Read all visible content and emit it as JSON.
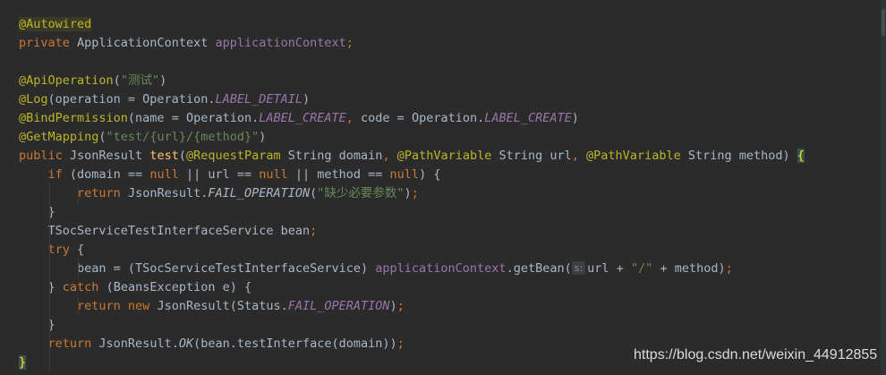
{
  "editor": {
    "lines": [
      [
        {
          "t": "@Autowired",
          "c": "ann-hl"
        }
      ],
      [
        {
          "t": "private ",
          "c": "kw"
        },
        {
          "t": "ApplicationContext ",
          "c": "plain"
        },
        {
          "t": "applicationContext",
          "c": "field"
        },
        {
          "t": ";",
          "c": "kw"
        }
      ],
      [],
      [
        {
          "t": "@ApiOperation",
          "c": "ann"
        },
        {
          "t": "(",
          "c": "plain"
        },
        {
          "t": "\"测试\"",
          "c": "str"
        },
        {
          "t": ")",
          "c": "plain"
        }
      ],
      [
        {
          "t": "@Log",
          "c": "ann"
        },
        {
          "t": "(operation = Operation.",
          "c": "plain"
        },
        {
          "t": "LABEL_DETAIL",
          "c": "static"
        },
        {
          "t": ")",
          "c": "plain"
        }
      ],
      [
        {
          "t": "@BindPermission",
          "c": "ann"
        },
        {
          "t": "(name = Operation.",
          "c": "plain"
        },
        {
          "t": "LABEL_CREATE",
          "c": "static"
        },
        {
          "t": ", ",
          "c": "kw"
        },
        {
          "t": "code = Operation.",
          "c": "plain"
        },
        {
          "t": "LABEL_CREATE",
          "c": "static"
        },
        {
          "t": ")",
          "c": "plain"
        }
      ],
      [
        {
          "t": "@GetMapping",
          "c": "ann"
        },
        {
          "t": "(",
          "c": "plain"
        },
        {
          "t": "\"test/{url}/{method}\"",
          "c": "str"
        },
        {
          "t": ")",
          "c": "plain"
        }
      ],
      [
        {
          "t": "public ",
          "c": "kw"
        },
        {
          "t": "JsonResult ",
          "c": "plain"
        },
        {
          "t": "test",
          "c": "fn"
        },
        {
          "t": "(",
          "c": "plain"
        },
        {
          "t": "@RequestParam ",
          "c": "ann"
        },
        {
          "t": "String domain",
          "c": "plain"
        },
        {
          "t": ", ",
          "c": "kw"
        },
        {
          "t": "@PathVariable ",
          "c": "ann"
        },
        {
          "t": "String url",
          "c": "plain"
        },
        {
          "t": ", ",
          "c": "kw"
        },
        {
          "t": "@PathVariable ",
          "c": "ann"
        },
        {
          "t": "String method) ",
          "c": "plain"
        },
        {
          "t": "{",
          "c": "brace-hl"
        }
      ],
      [
        {
          "t": "    ",
          "c": "plain"
        },
        {
          "t": "if ",
          "c": "kw"
        },
        {
          "t": "(domain == ",
          "c": "plain"
        },
        {
          "t": "null ",
          "c": "kw"
        },
        {
          "t": "|| url == ",
          "c": "plain"
        },
        {
          "t": "null ",
          "c": "kw"
        },
        {
          "t": "|| method == ",
          "c": "plain"
        },
        {
          "t": "null",
          "c": "kw"
        },
        {
          "t": ") {",
          "c": "plain"
        }
      ],
      [
        {
          "t": "        ",
          "c": "plain"
        },
        {
          "t": "return ",
          "c": "kw"
        },
        {
          "t": "JsonResult.",
          "c": "plain"
        },
        {
          "t": "FAIL_OPERATION",
          "c": "italic"
        },
        {
          "t": "(",
          "c": "plain"
        },
        {
          "t": "\"缺少必要参数\"",
          "c": "str"
        },
        {
          "t": ")",
          "c": "plain"
        },
        {
          "t": ";",
          "c": "kw"
        }
      ],
      [
        {
          "t": "    }",
          "c": "plain"
        }
      ],
      [
        {
          "t": "    TSocServiceTestInterfaceService bean",
          "c": "plain"
        },
        {
          "t": ";",
          "c": "kw"
        }
      ],
      [
        {
          "t": "    ",
          "c": "plain"
        },
        {
          "t": "try ",
          "c": "kw"
        },
        {
          "t": "{",
          "c": "plain"
        }
      ],
      [
        {
          "t": "        bean = (TSocServiceTestInterfaceService) ",
          "c": "plain"
        },
        {
          "t": "applicationContext",
          "c": "field"
        },
        {
          "t": ".getBean(",
          "c": "plain"
        },
        {
          "t": "s:",
          "c": "hint"
        },
        {
          "t": "url + ",
          "c": "plain"
        },
        {
          "t": "\"/\"",
          "c": "str"
        },
        {
          "t": " + method)",
          "c": "plain"
        },
        {
          "t": ";",
          "c": "kw"
        }
      ],
      [
        {
          "t": "    } ",
          "c": "plain"
        },
        {
          "t": "catch ",
          "c": "kw"
        },
        {
          "t": "(BeansException e) {",
          "c": "plain"
        }
      ],
      [
        {
          "t": "        ",
          "c": "plain"
        },
        {
          "t": "return new ",
          "c": "kw"
        },
        {
          "t": "JsonResult(Status.",
          "c": "plain"
        },
        {
          "t": "FAIL_OPERATION",
          "c": "static"
        },
        {
          "t": ")",
          "c": "plain"
        },
        {
          "t": ";",
          "c": "kw"
        }
      ],
      [
        {
          "t": "    }",
          "c": "plain"
        }
      ],
      [
        {
          "t": "    ",
          "c": "plain"
        },
        {
          "t": "return ",
          "c": "kw"
        },
        {
          "t": "JsonResult.",
          "c": "plain"
        },
        {
          "t": "OK",
          "c": "italic"
        },
        {
          "t": "(bean.testInterface(domain))",
          "c": "plain"
        },
        {
          "t": ";",
          "c": "kw"
        }
      ],
      [
        {
          "t": "}",
          "c": "caret-brace"
        }
      ]
    ]
  },
  "watermark": "https://blog.csdn.net/weixin_44912855"
}
